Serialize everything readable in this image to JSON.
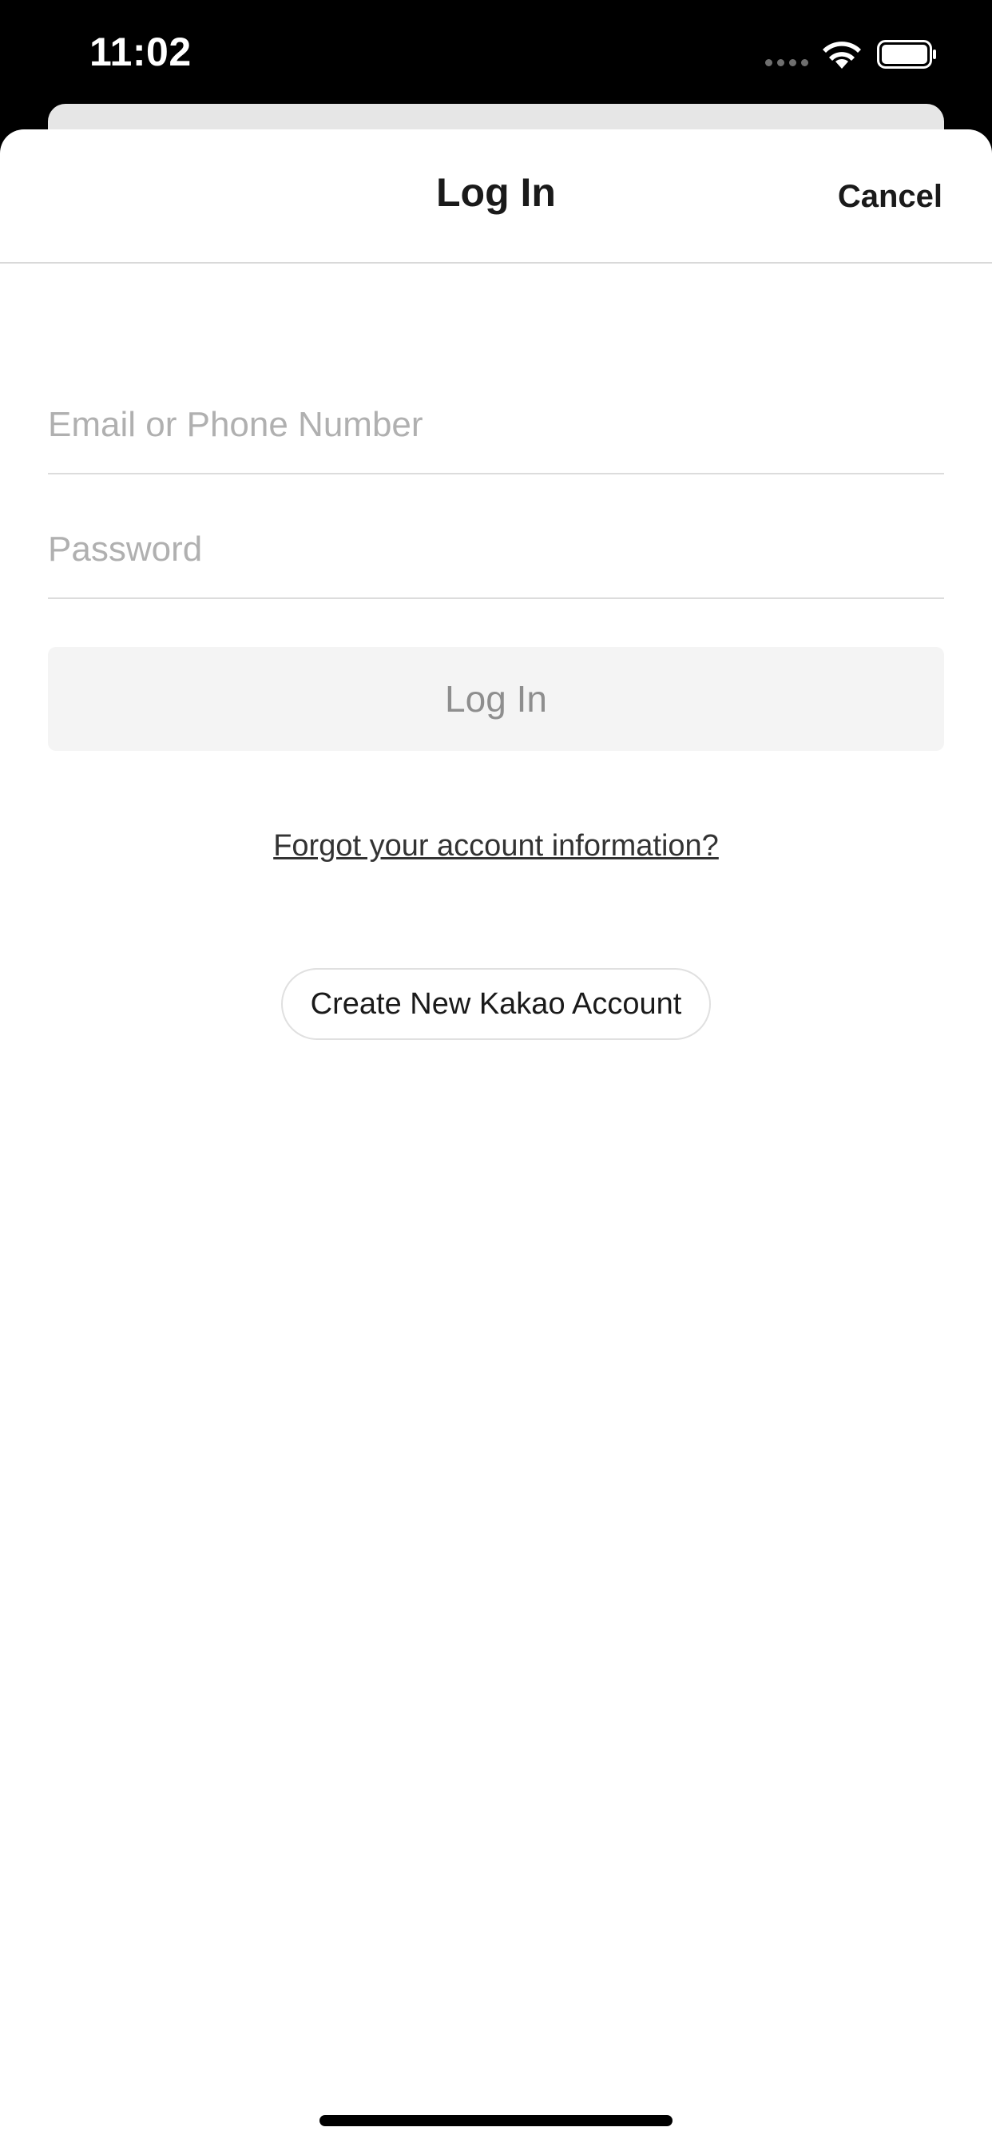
{
  "status_bar": {
    "time": "11:02",
    "icons": [
      "signal-dots-icon",
      "wifi-icon",
      "battery-icon"
    ]
  },
  "header": {
    "title": "Log In",
    "cancel_label": "Cancel"
  },
  "form": {
    "email_placeholder": "Email or Phone Number",
    "email_value": "",
    "password_placeholder": "Password",
    "password_value": "",
    "login_label": "Log In"
  },
  "links": {
    "forgot": "Forgot your account information?",
    "create_account": "Create New Kakao Account"
  },
  "colors": {
    "background": "#ffffff",
    "status_bar": "#000000",
    "placeholder": "#b0b0b0",
    "disabled_button_bg": "#f4f4f4",
    "disabled_button_text": "#8e8e8e"
  }
}
